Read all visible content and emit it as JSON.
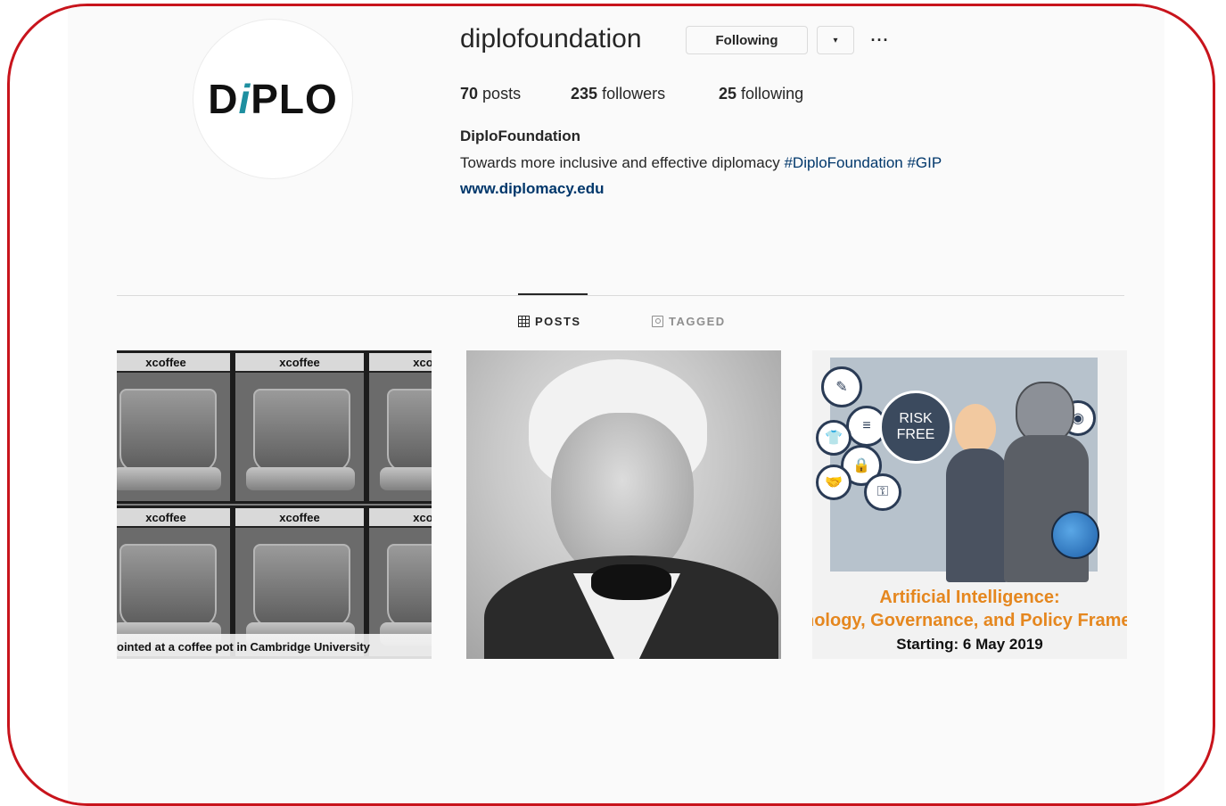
{
  "profile": {
    "logo_text_left": "D",
    "logo_text_i": "i",
    "logo_text_right": "PLO",
    "username": "diplofoundation",
    "following_button": "Following",
    "dropdown_glyph": "▾",
    "more_glyph": "···",
    "posts_count": "70",
    "posts_label": "posts",
    "followers_count": "235",
    "followers_label": "followers",
    "following_count": "25",
    "following_label": "following",
    "full_name": "DiploFoundation",
    "bio_text": "Towards more inclusive and effective diplomacy ",
    "bio_hashtags": "#DiploFoundation #GIP",
    "website": "www.diplomacy.edu"
  },
  "tabs": {
    "posts": "POSTS",
    "tagged": "TAGGED"
  },
  "posts": [
    {
      "tile_label": "xcoffee",
      "caption": "ointed at a coffee pot in Cambridge University"
    },
    {},
    {
      "bubble_text": "RISK FREE",
      "title": "Artificial Intelligence:",
      "subtitle": "nology, Governance, and Policy Framev",
      "date": "Starting: 6 May 2019"
    }
  ],
  "colors": {
    "frame": "#c8141c",
    "link": "#00376b",
    "ai_orange": "#e5871f",
    "logo_teal": "#1e8fa0"
  }
}
